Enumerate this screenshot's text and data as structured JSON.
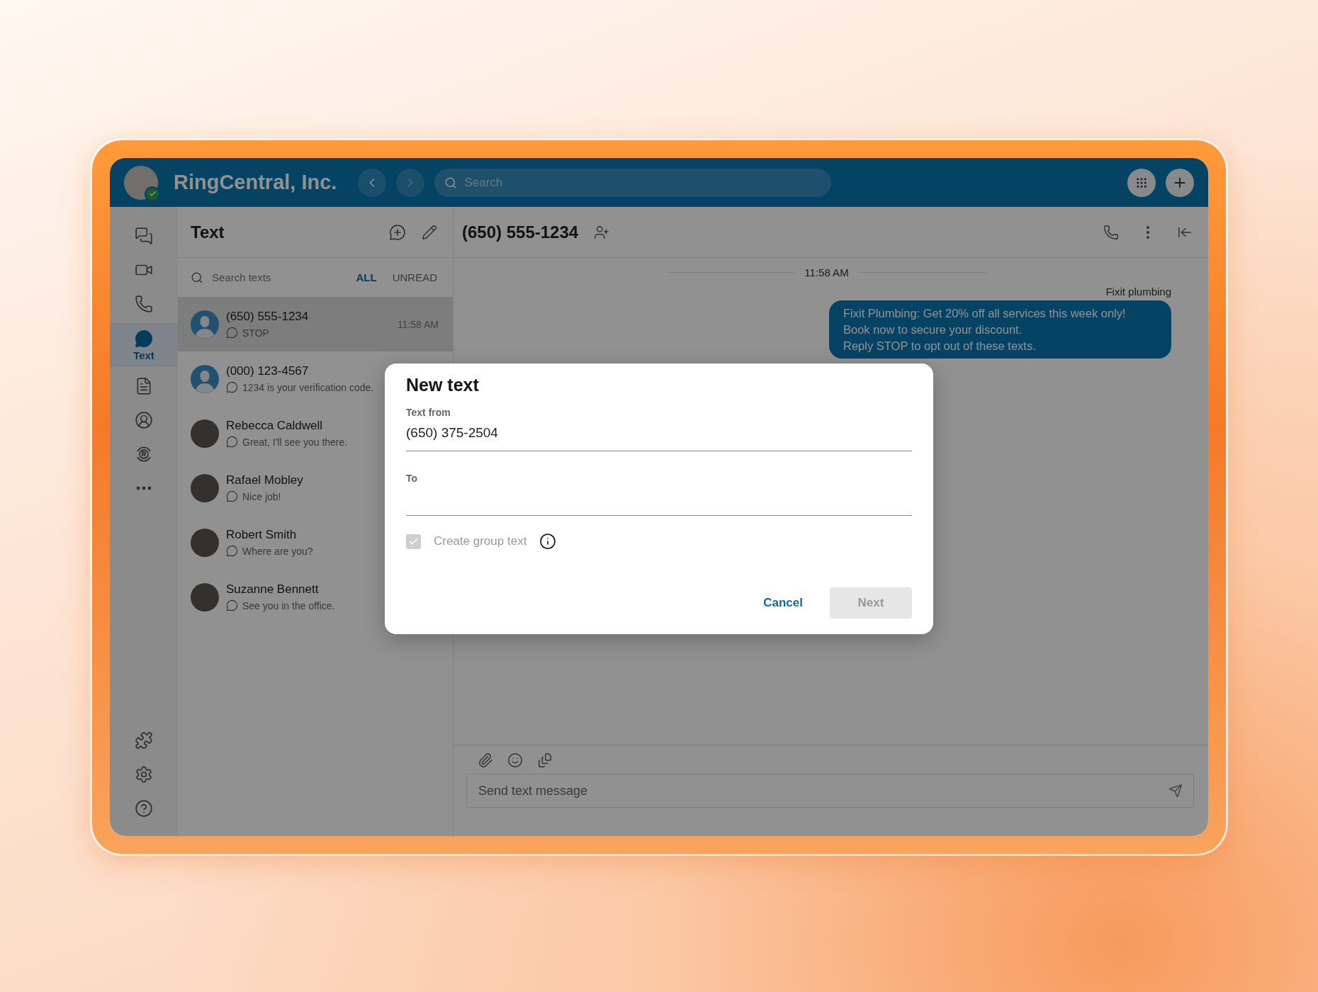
{
  "topbar": {
    "title": "RingCentral, Inc.",
    "search": {
      "placeholder": "Search"
    }
  },
  "nav": {
    "items": [
      {
        "kind": "messages",
        "selected": false
      },
      {
        "kind": "video",
        "selected": false
      },
      {
        "kind": "phone",
        "selected": false
      },
      {
        "kind": "text",
        "label": "Text",
        "selected": true
      },
      {
        "kind": "fax",
        "selected": false
      },
      {
        "kind": "contacts",
        "selected": false
      },
      {
        "kind": "rooms",
        "selected": false
      },
      {
        "kind": "more",
        "selected": false
      }
    ],
    "bottom": [
      {
        "kind": "apps"
      },
      {
        "kind": "settings"
      },
      {
        "kind": "help"
      }
    ]
  },
  "list": {
    "title": "Text",
    "search": {
      "placeholder": "Search texts"
    },
    "filters": [
      {
        "label": "ALL",
        "selected": true
      },
      {
        "label": "UNREAD",
        "selected": false
      }
    ],
    "conversations": [
      {
        "name": "(650) 555-1234",
        "preview": "STOP",
        "time": "11:58 AM",
        "photo": false,
        "selected": true
      },
      {
        "name": "(000) 123-4567",
        "preview": "1234 is your verification code.",
        "photo": false,
        "selected": false
      },
      {
        "name": "Rebecca Caldwell",
        "preview": "Great, I'll see you there.",
        "photo": true,
        "selected": false
      },
      {
        "name": "Rafael Mobley",
        "preview": "Nice job!",
        "photo": true,
        "selected": false
      },
      {
        "name": "Robert Smith",
        "preview": "Where are you?",
        "photo": true,
        "selected": false
      },
      {
        "name": "Suzanne Bennett",
        "preview": "See you in the office.",
        "photo": true,
        "selected": false
      }
    ]
  },
  "chat": {
    "title": "(650) 555-1234",
    "divider_time": "11:58 AM",
    "messages": [
      {
        "sender": "Fixit plumbing",
        "text": "Fixit Plumbing: Get 20% off all services this week only!\nBook now to secure your discount.\nReply STOP to opt out of these texts."
      }
    ],
    "composer": {
      "placeholder": "Send text message"
    }
  },
  "dialog": {
    "title": "New text",
    "from": {
      "label": "Text from",
      "value": "(650) 375-2504"
    },
    "to": {
      "label": "To"
    },
    "group": {
      "label": "Create group text",
      "checked": true,
      "disabled": true
    },
    "buttons": [
      {
        "label": "Cancel",
        "kind": "link",
        "disabled": false
      },
      {
        "label": "Next",
        "kind": "primary",
        "disabled": true
      }
    ]
  }
}
